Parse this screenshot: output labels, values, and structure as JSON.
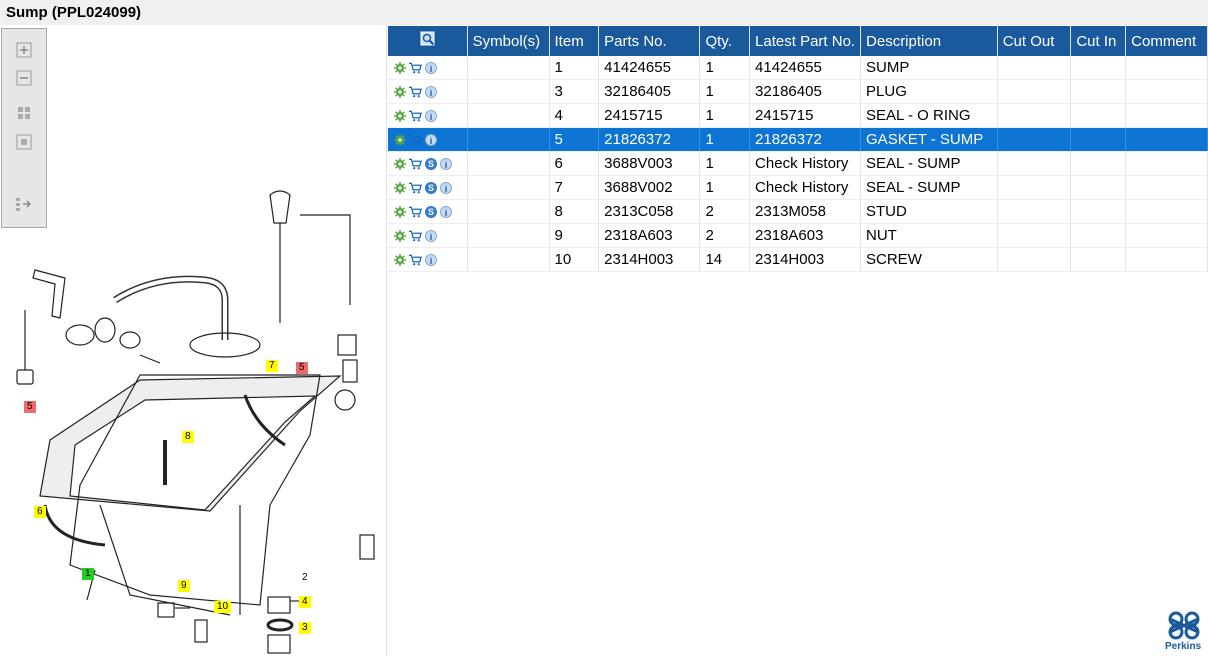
{
  "window": {
    "title": "Sump (PPL024099)"
  },
  "zoom_toolbar": {
    "icons": [
      "zoom-in-icon",
      "zoom-out-icon",
      "fit-grid-icon",
      "actual-size-icon",
      "export-icon"
    ]
  },
  "diagram": {
    "callouts": [
      {
        "label": "7",
        "style": "yellow"
      },
      {
        "label": "5",
        "style": "red"
      },
      {
        "label": "5",
        "style": "red"
      },
      {
        "label": "8",
        "style": "yellow"
      },
      {
        "label": "6",
        "style": "yellow"
      },
      {
        "label": "1",
        "style": "green"
      },
      {
        "label": "9",
        "style": "yellow"
      },
      {
        "label": "10",
        "style": "yellow"
      },
      {
        "label": "2",
        "style": "plain"
      },
      {
        "label": "4",
        "style": "yellow"
      },
      {
        "label": "3",
        "style": "yellow"
      }
    ]
  },
  "table": {
    "header_icon": "search-icon",
    "columns": [
      "Symbol(s)",
      "Item",
      "Parts No.",
      "Qty.",
      "Latest Part No.",
      "Description",
      "Cut Out",
      "Cut In",
      "Comment"
    ],
    "rows": [
      {
        "icons": [
          "gear-icon",
          "cart-icon",
          "info-icon"
        ],
        "item": "1",
        "parts_no": "41424655",
        "qty": "1",
        "latest": "41424655",
        "desc": "SUMP",
        "selected": false
      },
      {
        "icons": [
          "gear-icon",
          "cart-icon",
          "info-icon"
        ],
        "item": "3",
        "parts_no": "32186405",
        "qty": "1",
        "latest": "32186405",
        "desc": "PLUG",
        "selected": false
      },
      {
        "icons": [
          "gear-icon",
          "cart-icon",
          "info-icon"
        ],
        "item": "4",
        "parts_no": "2415715",
        "qty": "1",
        "latest": "2415715",
        "desc": "SEAL - O RING",
        "selected": false
      },
      {
        "icons": [
          "gear-icon",
          "cart-icon",
          "info-icon"
        ],
        "item": "5",
        "parts_no": "21826372",
        "qty": "1",
        "latest": "21826372",
        "desc": "GASKET - SUMP",
        "selected": true
      },
      {
        "icons": [
          "gear-icon",
          "cart-icon",
          "s-icon",
          "info-icon"
        ],
        "item": "6",
        "parts_no": "3688V003",
        "qty": "1",
        "latest": "Check History",
        "desc": "SEAL - SUMP",
        "selected": false
      },
      {
        "icons": [
          "gear-icon",
          "cart-icon",
          "s-icon",
          "info-icon"
        ],
        "item": "7",
        "parts_no": "3688V002",
        "qty": "1",
        "latest": "Check History",
        "desc": "SEAL - SUMP",
        "selected": false
      },
      {
        "icons": [
          "gear-icon",
          "cart-icon",
          "s-icon",
          "info-icon"
        ],
        "item": "8",
        "parts_no": "2313C058",
        "qty": "2",
        "latest": "2313M058",
        "desc": "STUD",
        "selected": false
      },
      {
        "icons": [
          "gear-icon",
          "cart-icon",
          "info-icon"
        ],
        "item": "9",
        "parts_no": "2318A603",
        "qty": "2",
        "latest": "2318A603",
        "desc": "NUT",
        "selected": false
      },
      {
        "icons": [
          "gear-icon",
          "cart-icon",
          "info-icon"
        ],
        "item": "10",
        "parts_no": "2314H003",
        "qty": "14",
        "latest": "2314H003",
        "desc": "SCREW",
        "selected": false
      }
    ]
  },
  "brand": {
    "name": "Perkins",
    "color": "#1a5a9c"
  },
  "colors": {
    "header_bg": "#1a5a9c",
    "selected_row": "#0e74d4",
    "callout_yellow": "#ffff00",
    "callout_red": "#ef6b6b",
    "callout_green": "#22cc22"
  }
}
